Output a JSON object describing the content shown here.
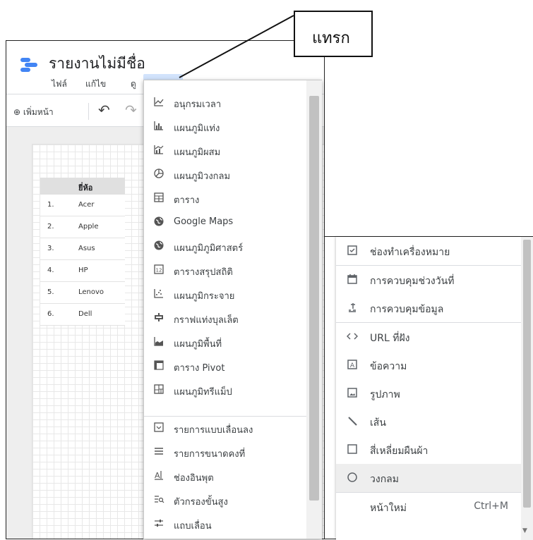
{
  "callout": {
    "label": "แทรก"
  },
  "app": {
    "title": "รายงานไม่มีชื่อ",
    "menu": [
      "ไฟล์",
      "แก้ไข",
      "ดู"
    ],
    "add_page": "⊕ เพิ่มหน้า"
  },
  "table": {
    "header": "ยี่ห้อ",
    "rows": [
      {
        "n": "1.",
        "v": "Acer"
      },
      {
        "n": "2.",
        "v": "Apple"
      },
      {
        "n": "3.",
        "v": "Asus"
      },
      {
        "n": "4.",
        "v": "HP"
      },
      {
        "n": "5.",
        "v": "Lenovo"
      },
      {
        "n": "6.",
        "v": "Dell"
      }
    ]
  },
  "insert_menu": {
    "items": [
      {
        "icon": "timeseries-chart-icon",
        "label": "อนุกรมเวลา"
      },
      {
        "icon": "bar-chart-icon",
        "label": "แผนภูมิแท่ง"
      },
      {
        "icon": "combo-chart-icon",
        "label": "แผนภูมิผสม"
      },
      {
        "icon": "pie-chart-icon",
        "label": "แผนภูมิวงกลม"
      },
      {
        "icon": "table-icon",
        "label": "ตาราง"
      },
      {
        "icon": "google-maps-icon",
        "label": "Google Maps"
      },
      {
        "icon": "geo-chart-icon",
        "label": "แผนภูมิภูมิศาสตร์"
      },
      {
        "icon": "scorecard-icon",
        "label": "ตารางสรุปสถิติ"
      },
      {
        "icon": "scatter-chart-icon",
        "label": "แผนภูมิกระจาย"
      },
      {
        "icon": "bullet-chart-icon",
        "label": "กราฟแท่งบุลเล็ต"
      },
      {
        "icon": "area-chart-icon",
        "label": "แผนภูมิพื้นที่"
      },
      {
        "icon": "pivot-table-icon",
        "label": "ตาราง Pivot"
      },
      {
        "icon": "treemap-icon",
        "label": "แผนภูมิทรีแม็ป"
      },
      {
        "icon": "dropdown-list-icon",
        "label": "รายการแบบเลื่อนลง"
      },
      {
        "icon": "fixed-size-list-icon",
        "label": "รายการขนาดคงที่"
      },
      {
        "icon": "input-box-icon",
        "label": "ช่องอินพุต"
      },
      {
        "icon": "advanced-filter-icon",
        "label": "ตัวกรองขั้นสูง"
      },
      {
        "icon": "slider-icon",
        "label": "แถบเลื่อน"
      }
    ]
  },
  "insert_panel": {
    "items": [
      {
        "icon": "checkbox-icon",
        "label": "ช่องทำเครื่องหมาย"
      },
      {
        "icon": "calendar-icon",
        "label": "การควบคุมช่วงวันที่"
      },
      {
        "icon": "data-control-icon",
        "label": "การควบคุมข้อมูล"
      },
      {
        "icon": "embed-code-icon",
        "label": "URL ที่ฝัง"
      },
      {
        "icon": "text-box-icon",
        "label": "ข้อความ"
      },
      {
        "icon": "image-icon",
        "label": "รูปภาพ"
      },
      {
        "icon": "line-icon",
        "label": "เส้น"
      },
      {
        "icon": "rectangle-icon",
        "label": "สี่เหลี่ยมผืนผ้า"
      },
      {
        "icon": "circle-icon",
        "label": "วงกลม"
      }
    ],
    "new_page": {
      "label": "หน้าใหม่",
      "shortcut": "Ctrl+M"
    }
  },
  "colors": {
    "accent": "#4285f4",
    "menu_highlight": "#d2e3fc"
  }
}
